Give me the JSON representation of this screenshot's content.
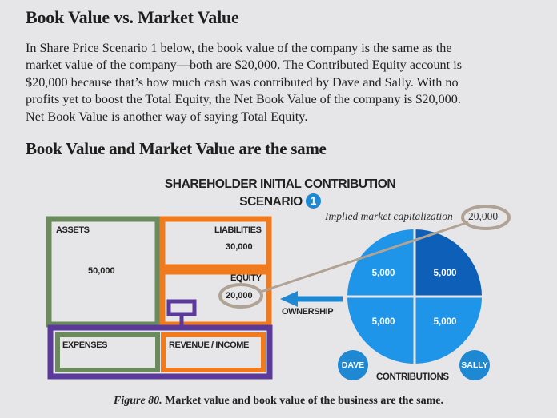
{
  "heading": "Book Value vs. Market Value",
  "paragraph_lines": [
    "In Share Price Scenario 1 below, the book value of the company is the same as the",
    "market value of the company—both are $20,000. The Contributed Equity account is",
    "$20,000 because that’s how much cash was contributed by Dave and Sally. With no",
    "profits yet to boost the Total Equity, the Net Book Value of the company is $20,000.",
    "Net Book Value is another way of saying Total Equity."
  ],
  "subheading": "Book Value and Market Value are the same",
  "diagram": {
    "title_line1": "SHAREHOLDER INITIAL CONTRIBUTION",
    "title_line2": "SCENARIO",
    "scenario_number": "1",
    "assets_label": "ASSETS",
    "assets_value": "50,000",
    "liabilities_label": "LIABILITIES",
    "liabilities_value": "30,000",
    "equity_label": "EQUITY",
    "equity_value": "20,000",
    "expenses_label": "EXPENSES",
    "revenue_label": "REVENUE / INCOME",
    "ownership_label": "OWNERSHIP",
    "implied_label": "Implied market capitalization",
    "implied_value": "20,000",
    "pie_values": [
      "5,000",
      "5,000",
      "5,000",
      "5,000"
    ],
    "dave_label": "DAVE",
    "sally_label": "SALLY",
    "contributions_label": "CONTRIBUTIONS",
    "colors": {
      "assets_border": "#6b8a5e",
      "liab_equity_border": "#f07a1e",
      "income_border": "#5b3a9b",
      "pie_light": "#1e95e8",
      "pie_dark": "#0d5fb8",
      "ellipse": "#b0a294"
    }
  },
  "caption_figure": "Figure 80.",
  "caption_text": " Market value and book value of the business are the same."
}
